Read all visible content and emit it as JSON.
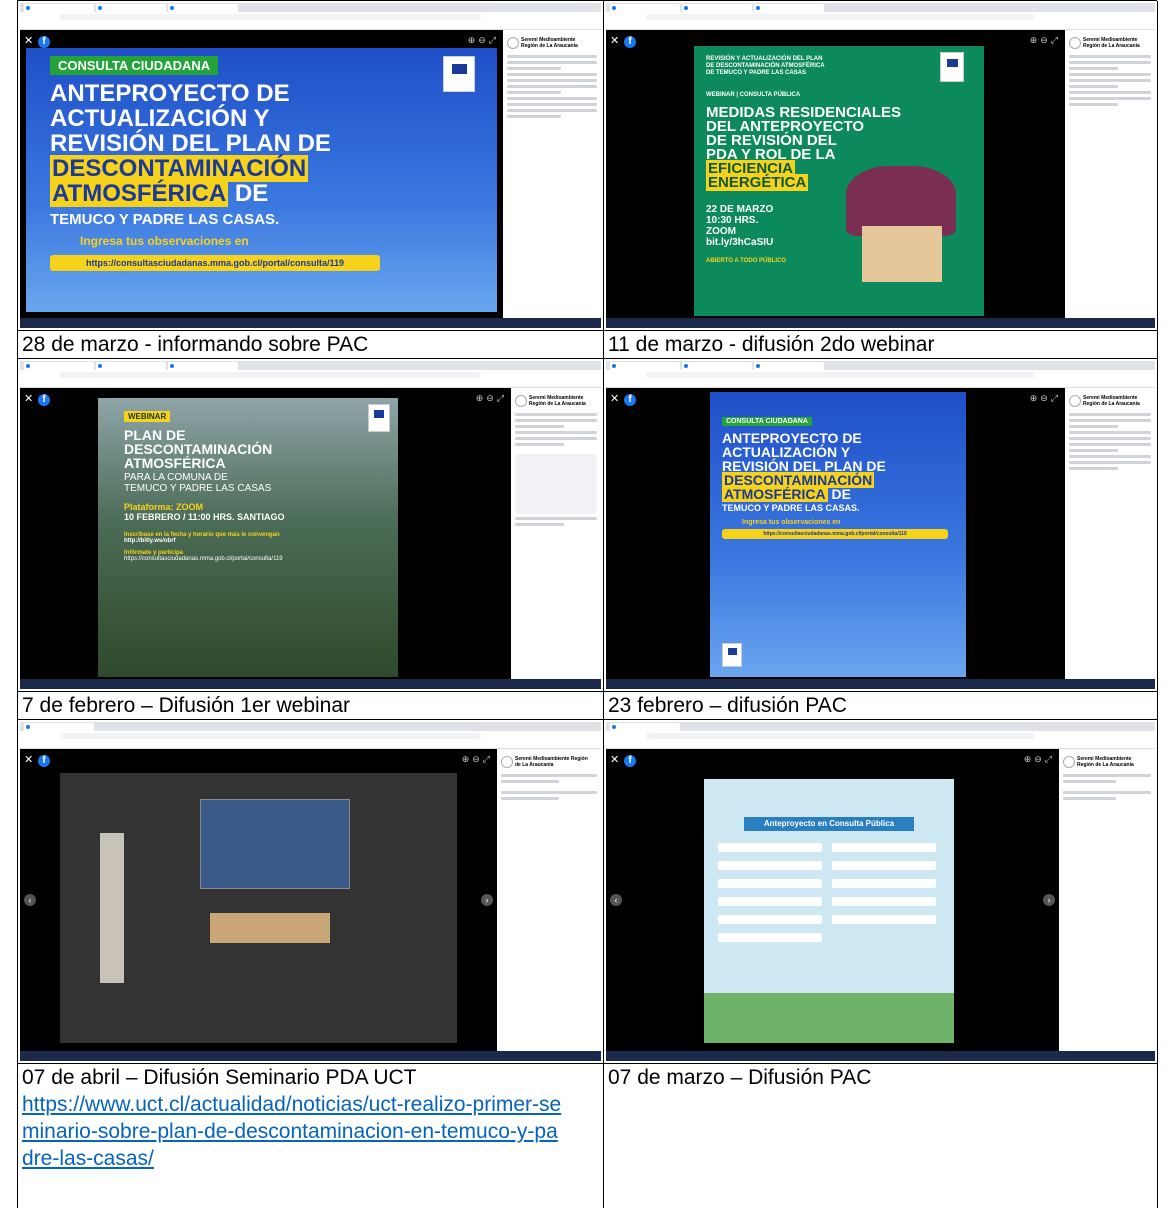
{
  "captions": {
    "c1": "28 de marzo - informando sobre PAC",
    "c2": "11 de marzo - difusión 2do webinar",
    "c3": "7 de febrero – Difusión 1er webinar",
    "c4": "23 febrero – difusión PAC",
    "c5": "07 de abril – Difusión Seminario PDA UCT",
    "c5_link": "https://www.uct.cl/actualidad/noticias/uct-realizo-primer-seminario-sobre-plan-de-descontaminacion-en-temuco-y-padre-las-casas/",
    "c6": "07 de marzo – Difusión PAC"
  },
  "posters": {
    "consulta": {
      "badge": "CONSULTA CIUDADANA",
      "l1": "ANTEPROYECTO DE",
      "l2": "ACTUALIZACIÓN Y",
      "l3": "REVISIÓN DEL PLAN DE",
      "l4": "DESCONTAMINACIÓN",
      "l5a": "ATMOSFÉRICA",
      "l5b": " DE",
      "l6": "TEMUCO Y PADRE LAS CASAS.",
      "l7": "Ingresa tus observaciones en",
      "url": "https://consultasciudadanas.mma.gob.cl/portal/consulta/119"
    },
    "webinar2": {
      "top1": "REVISIÓN Y ACTUALIZACIÓN DEL PLAN",
      "top2": "DE DESCONTAMINACIÓN ATMOSFÉRICA",
      "top3": "DE TEMUCO Y PADRE LAS CASAS",
      "tag": "WEBINAR | CONSULTA PÚBLICA",
      "h1": "MEDIDAS RESIDENCIALES",
      "h2": "DEL ANTEPROYECTO",
      "h3": "DE REVISIÓN DEL",
      "h4": "PDA Y ROL DE LA",
      "h5": "EFICIENCIA",
      "h6": "ENERGÉTICA",
      "d1": "22 DE MARZO",
      "d2": "10:30 HRS.",
      "d3": "ZOOM",
      "d4": "bit.ly/3hCaSIU",
      "foot": "ABIERTO A TODO PÚBLICO"
    },
    "webinar1": {
      "badge": "WEBINAR",
      "h1": "PLAN DE",
      "h2": "DESCONTAMINACIÓN",
      "h3": "ATMOSFÉRICA",
      "h4": "PARA LA COMUNA DE",
      "h5": "TEMUCO Y PADRE LAS CASAS",
      "p1": "Plataforma: ZOOM",
      "p2": "10 FEBRERO / 11:00 HRS. SANTIAGO",
      "p3": "Inscríbase en la fecha y horario que más le convengan",
      "p4": "http://bitly.ws/obrf",
      "p5": "Infórmate y participa",
      "p6": "https://consultasciudadanas.mma.gob.cl/portal/consulta/119"
    },
    "infografia": {
      "band": "Anteproyecto en Consulta Pública"
    }
  },
  "sidebar": {
    "page_name": "Seremi Medioambiente Región de La Araucanía"
  }
}
